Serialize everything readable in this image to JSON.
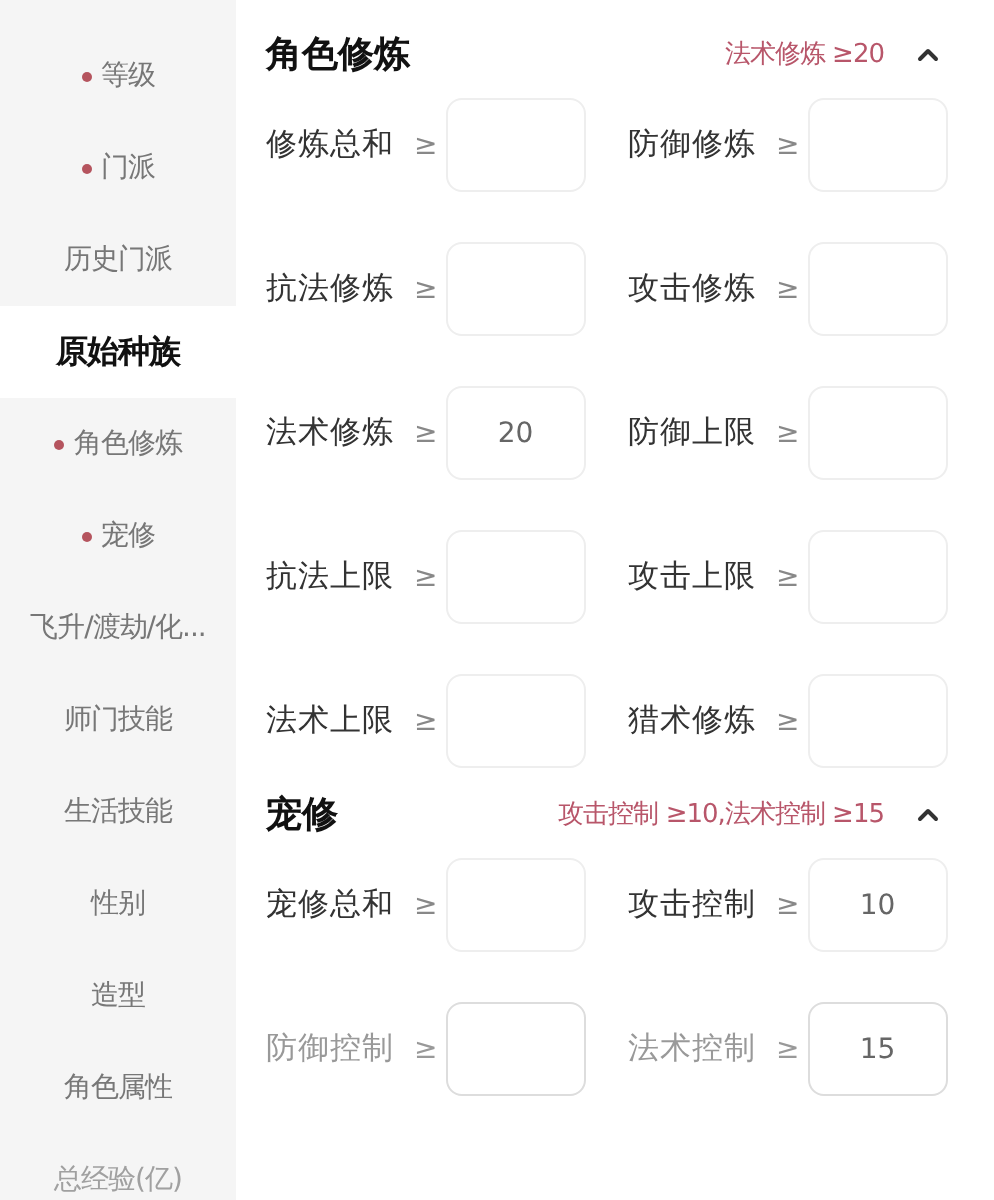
{
  "sidebar": {
    "items": [
      {
        "label": "等级",
        "dot": true,
        "selected": false
      },
      {
        "label": "门派",
        "dot": true,
        "selected": false
      },
      {
        "label": "历史门派",
        "dot": false,
        "selected": false
      },
      {
        "label": "原始种族",
        "dot": false,
        "selected": true
      },
      {
        "label": "角色修炼",
        "dot": true,
        "selected": false
      },
      {
        "label": "宠修",
        "dot": true,
        "selected": false
      },
      {
        "label": "飞升/渡劫/化...",
        "dot": false,
        "selected": false
      },
      {
        "label": "师门技能",
        "dot": false,
        "selected": false
      },
      {
        "label": "生活技能",
        "dot": false,
        "selected": false
      },
      {
        "label": "性别",
        "dot": false,
        "selected": false
      },
      {
        "label": "造型",
        "dot": false,
        "selected": false
      },
      {
        "label": "角色属性",
        "dot": false,
        "selected": false
      },
      {
        "label": "总经验(亿)",
        "dot": false,
        "selected": false
      }
    ]
  },
  "sections": [
    {
      "title": "角色修炼",
      "summary": "法术修炼 ≥20",
      "expanded": true,
      "fields": [
        {
          "label": "修炼总和",
          "operator": "≥"
        },
        {
          "label": "防御修炼",
          "operator": "≥"
        },
        {
          "label": "抗法修炼",
          "operator": "≥"
        },
        {
          "label": "攻击修炼",
          "operator": "≥"
        },
        {
          "label": "法术修炼",
          "operator": "≥",
          "value": "20"
        },
        {
          "label": "防御上限",
          "operator": "≥"
        },
        {
          "label": "抗法上限",
          "operator": "≥"
        },
        {
          "label": "攻击上限",
          "operator": "≥"
        },
        {
          "label": "法术上限",
          "operator": "≥"
        },
        {
          "label": "猎术修炼",
          "operator": "≥"
        }
      ]
    },
    {
      "title": "宠修",
      "summary": "攻击控制 ≥10,法术控制 ≥15",
      "expanded": true,
      "fields": [
        {
          "label": "宠修总和",
          "operator": "≥"
        },
        {
          "label": "攻击控制",
          "operator": "≥",
          "value": "10"
        },
        {
          "label": "防御控制",
          "operator": "≥"
        },
        {
          "label": "法术控制",
          "operator": "≥",
          "value": "15"
        }
      ]
    }
  ]
}
